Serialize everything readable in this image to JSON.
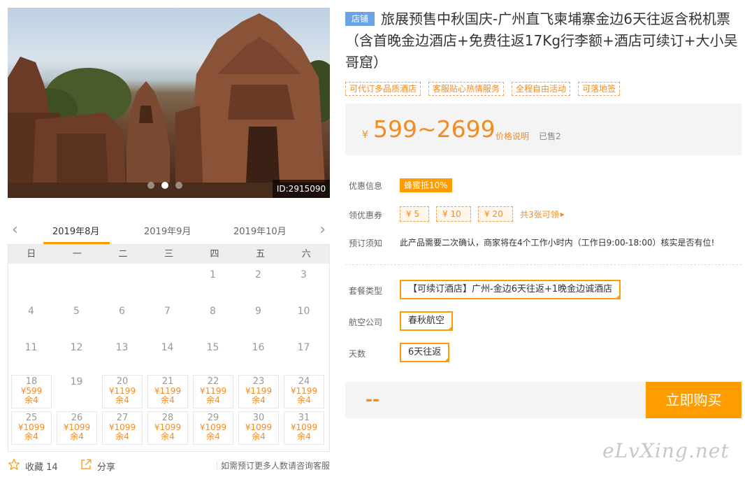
{
  "gallery": {
    "id_label": "ID:2915090",
    "slide_count": 3,
    "active_slide": 2
  },
  "calendar": {
    "months": [
      "2019年8月",
      "2019年9月",
      "2019年10月"
    ],
    "active_month": "2019年8月",
    "weekdays": [
      "日",
      "一",
      "二",
      "三",
      "四",
      "五",
      "六"
    ],
    "weeks": [
      [
        {
          "d": ""
        },
        {
          "d": ""
        },
        {
          "d": ""
        },
        {
          "d": ""
        },
        {
          "d": "1"
        },
        {
          "d": "2"
        },
        {
          "d": "3"
        }
      ],
      [
        {
          "d": "4"
        },
        {
          "d": "5"
        },
        {
          "d": "6"
        },
        {
          "d": "7"
        },
        {
          "d": "8"
        },
        {
          "d": "9"
        },
        {
          "d": "10"
        }
      ],
      [
        {
          "d": "11"
        },
        {
          "d": "12"
        },
        {
          "d": "13"
        },
        {
          "d": "14"
        },
        {
          "d": "15"
        },
        {
          "d": "16"
        },
        {
          "d": "17"
        }
      ],
      [
        {
          "d": "18",
          "p": "¥599",
          "r": "余4"
        },
        {
          "d": "19"
        },
        {
          "d": "20",
          "p": "¥1199",
          "r": "余4"
        },
        {
          "d": "21",
          "p": "¥1199",
          "r": "余4"
        },
        {
          "d": "22",
          "p": "¥1199",
          "r": "余4"
        },
        {
          "d": "23",
          "p": "¥1199",
          "r": "余4"
        },
        {
          "d": "24",
          "p": "¥1199",
          "r": "余4"
        }
      ],
      [
        {
          "d": "25",
          "p": "¥1099",
          "r": "余4"
        },
        {
          "d": "26",
          "p": "¥1099",
          "r": "余4"
        },
        {
          "d": "27",
          "p": "¥1099",
          "r": "余4"
        },
        {
          "d": "28",
          "p": "¥1099",
          "r": "余4"
        },
        {
          "d": "29",
          "p": "¥1099",
          "r": "余4"
        },
        {
          "d": "30",
          "p": "¥1099",
          "r": "余4"
        },
        {
          "d": "31",
          "p": "¥1099",
          "r": "余4"
        }
      ]
    ]
  },
  "actions": {
    "favorite_label": "收藏 14",
    "share_label": "分享",
    "consult_text": "如需预订更多人数请咨询客服"
  },
  "product": {
    "shop_badge": "店铺",
    "title": "旅展预售中秋国庆-广州直飞柬埔寨金边6天往返含税机票（含首晚金边酒店+免费往返17Kg行李额+酒店可续订+大小吴哥窟）",
    "tags": [
      "可代订多品质酒店",
      "客服贴心热情服务",
      "全程自由活动",
      "可落地签"
    ]
  },
  "price": {
    "currency": "¥",
    "range": "599~2699",
    "explain_label": "价格说明",
    "sold_label": "已售2"
  },
  "promo": {
    "discount_label": "优惠信息",
    "discount_badge": "蜂蜜抵10%",
    "coupon_label": "领优惠券",
    "coupons": [
      "¥ 5",
      "¥ 10",
      "¥ 20"
    ],
    "coupon_more": "共3张可领",
    "notice_label": "预订须知",
    "notice_text": "此产品需要二次确认，商家将在4个工作小时内（工作日9:00-18:00）核实是否有位!"
  },
  "options": {
    "package_label": "套餐类型",
    "package_value": "【可续订酒店】广州-金边6天往返+1晚金边诚酒店",
    "airline_label": "航空公司",
    "airline_value": "春秋航空",
    "days_label": "天数",
    "days_value": "6天往返"
  },
  "purchase": {
    "total_placeholder": "--",
    "buy_label": "立即购买"
  },
  "watermark": "eLvXing.net",
  "colors": {
    "accent": "#ff9d00",
    "price": "#f58a1f",
    "shop_badge": "#6aa3e6"
  }
}
